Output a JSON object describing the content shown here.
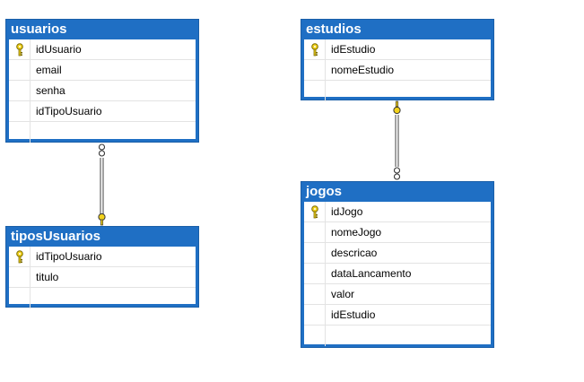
{
  "tables": {
    "usuarios": {
      "name": "usuarios",
      "columns": [
        {
          "name": "idUsuario",
          "primary_key": true
        },
        {
          "name": "email",
          "primary_key": false
        },
        {
          "name": "senha",
          "primary_key": false
        },
        {
          "name": "idTipoUsuario",
          "primary_key": false
        }
      ]
    },
    "tiposUsuarios": {
      "name": "tiposUsuarios",
      "columns": [
        {
          "name": "idTipoUsuario",
          "primary_key": true
        },
        {
          "name": "titulo",
          "primary_key": false
        }
      ]
    },
    "estudios": {
      "name": "estudios",
      "columns": [
        {
          "name": "idEstudio",
          "primary_key": true
        },
        {
          "name": "nomeEstudio",
          "primary_key": false
        }
      ]
    },
    "jogos": {
      "name": "jogos",
      "columns": [
        {
          "name": "idJogo",
          "primary_key": true
        },
        {
          "name": "nomeJogo",
          "primary_key": false
        },
        {
          "name": "descricao",
          "primary_key": false
        },
        {
          "name": "dataLancamento",
          "primary_key": false
        },
        {
          "name": "valor",
          "primary_key": false
        },
        {
          "name": "idEstudio",
          "primary_key": false
        }
      ]
    }
  },
  "relationships": [
    {
      "from": "usuarios",
      "to": "tiposUsuarios",
      "many_side": "usuarios",
      "one_side": "tiposUsuarios"
    },
    {
      "from": "jogos",
      "to": "estudios",
      "many_side": "jogos",
      "one_side": "estudios"
    }
  ],
  "colors": {
    "header": "#1f6fc4",
    "key": "#f2d21b",
    "line": "#6e6e6e"
  },
  "icons": {
    "primary_key": "key-icon",
    "many_end": "infinity-icon",
    "one_end": "key-icon"
  }
}
